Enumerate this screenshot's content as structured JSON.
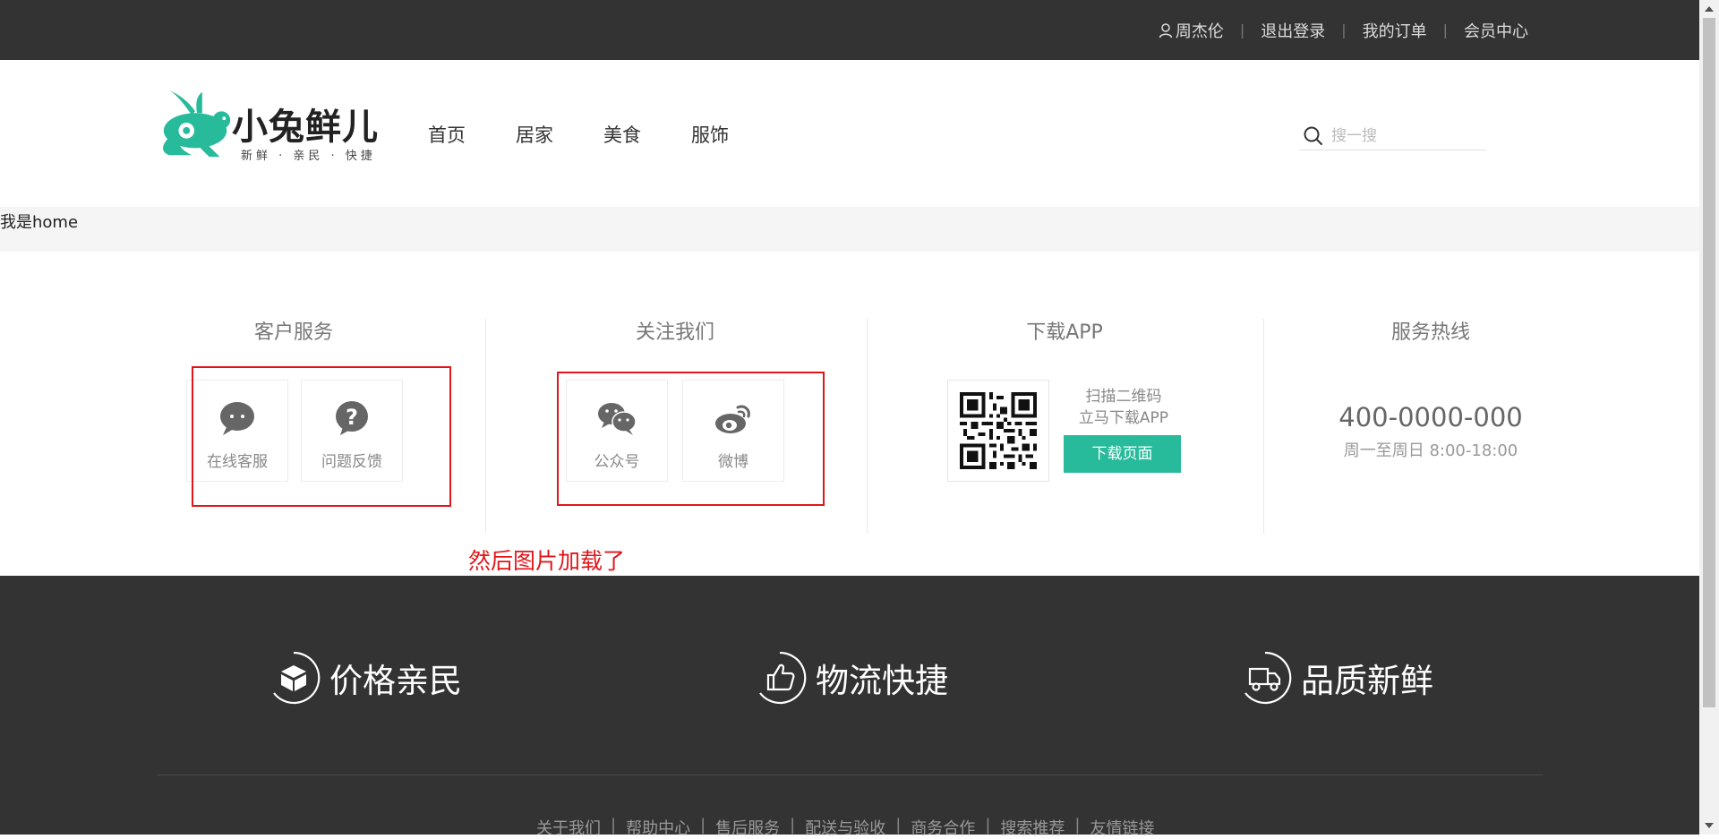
{
  "topbar": {
    "user_name": "周杰伦",
    "links": [
      "退出登录",
      "我的订单",
      "会员中心"
    ],
    "separator": "|"
  },
  "header": {
    "logo_title": "小兔鲜儿",
    "logo_subtitle": "新鲜 · 亲民 · 快捷",
    "nav": [
      "首页",
      "居家",
      "美食",
      "服饰"
    ],
    "search_placeholder": "搜一搜"
  },
  "home_text": "我是home",
  "service": {
    "customer_service": {
      "title": "客户服务",
      "items": [
        {
          "label": "在线客服",
          "icon": "chat-bubble-icon"
        },
        {
          "label": "问题反馈",
          "icon": "question-bubble-icon"
        }
      ]
    },
    "follow_us": {
      "title": "关注我们",
      "items": [
        {
          "label": "公众号",
          "icon": "wechat-icon"
        },
        {
          "label": "微博",
          "icon": "weibo-icon"
        }
      ]
    },
    "download_app": {
      "title": "下载APP",
      "line1": "扫描二维码",
      "line2": "立马下载APP",
      "button": "下载页面"
    },
    "hotline": {
      "title": "服务热线",
      "number": "400-0000-000",
      "hours": "周一至周日 8:00-18:00"
    },
    "annotation": "然后图片加载了"
  },
  "footer": {
    "features": [
      {
        "label": "价格亲民",
        "icon": "box-icon"
      },
      {
        "label": "物流快捷",
        "icon": "thumbs-up-icon"
      },
      {
        "label": "品质新鲜",
        "icon": "truck-icon"
      }
    ],
    "links": [
      "关于我们",
      "帮助中心",
      "售后服务",
      "配送与验收",
      "商务合作",
      "搜索推荐",
      "友情链接"
    ]
  },
  "colors": {
    "dark_bg": "#333333",
    "brand_green": "#27ba9b",
    "annotation_red": "#e0161b",
    "strip_bg": "#f5f5f5"
  }
}
